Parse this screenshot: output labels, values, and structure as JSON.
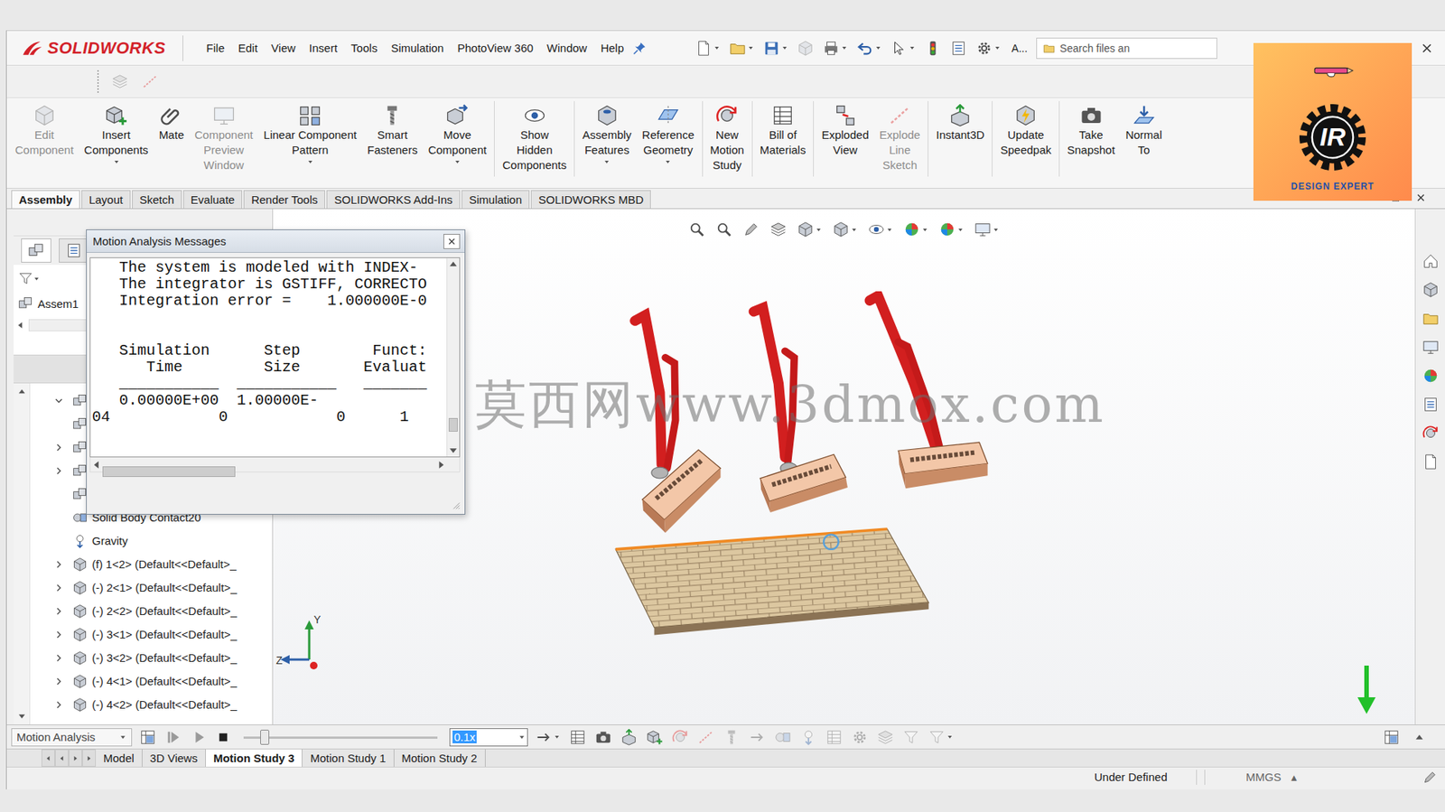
{
  "app": {
    "logo_text": "SOLIDWORKS"
  },
  "menu": [
    "File",
    "Edit",
    "View",
    "Insert",
    "Tools",
    "Simulation",
    "PhotoView 360",
    "Window",
    "Help"
  ],
  "quick_access": {
    "more_label": "A..."
  },
  "search": {
    "placeholder": "Search files an"
  },
  "ribbon": {
    "groups": [
      [
        {
          "label_lines": [
            "Edit",
            "Component"
          ],
          "disabled": true,
          "dropdown": false
        },
        {
          "label_lines": [
            "Insert",
            "Components"
          ],
          "disabled": false,
          "dropdown": true
        },
        {
          "label_lines": [
            "Mate"
          ],
          "disabled": false,
          "dropdown": false
        },
        {
          "label_lines": [
            "Component",
            "Preview",
            "Window"
          ],
          "disabled": true,
          "dropdown": false
        },
        {
          "label_lines": [
            "Linear Component",
            "Pattern"
          ],
          "disabled": false,
          "dropdown": true
        },
        {
          "label_lines": [
            "Smart",
            "Fasteners"
          ],
          "disabled": false,
          "dropdown": false
        },
        {
          "label_lines": [
            "Move",
            "Component"
          ],
          "disabled": false,
          "dropdown": true
        }
      ],
      [
        {
          "label_lines": [
            "Show",
            "Hidden",
            "Components"
          ],
          "disabled": false,
          "dropdown": false
        }
      ],
      [
        {
          "label_lines": [
            "Assembly",
            "Features"
          ],
          "disabled": false,
          "dropdown": true
        },
        {
          "label_lines": [
            "Reference",
            "Geometry"
          ],
          "disabled": false,
          "dropdown": true
        }
      ],
      [
        {
          "label_lines": [
            "New",
            "Motion",
            "Study"
          ],
          "disabled": false,
          "dropdown": false
        }
      ],
      [
        {
          "label_lines": [
            "Bill of",
            "Materials"
          ],
          "disabled": false,
          "dropdown": false
        }
      ],
      [
        {
          "label_lines": [
            "Exploded",
            "View"
          ],
          "disabled": false,
          "dropdown": false
        },
        {
          "label_lines": [
            "Explode",
            "Line",
            "Sketch"
          ],
          "disabled": true,
          "dropdown": false
        }
      ],
      [
        {
          "label_lines": [
            "Instant3D"
          ],
          "disabled": false,
          "dropdown": false
        }
      ],
      [
        {
          "label_lines": [
            "Update",
            "Speedpak"
          ],
          "disabled": false,
          "dropdown": false
        }
      ],
      [
        {
          "label_lines": [
            "Take",
            "Snapshot"
          ],
          "disabled": false,
          "dropdown": false
        },
        {
          "label_lines": [
            "Normal",
            "To"
          ],
          "disabled": false,
          "dropdown": false
        }
      ]
    ]
  },
  "command_tabs": [
    {
      "label": "Assembly",
      "selected": true
    },
    {
      "label": "Layout",
      "selected": false
    },
    {
      "label": "Sketch",
      "selected": false
    },
    {
      "label": "Evaluate",
      "selected": false
    },
    {
      "label": "Render Tools",
      "selected": false
    },
    {
      "label": "SOLIDWORKS Add-Ins",
      "selected": false
    },
    {
      "label": "Simulation",
      "selected": false
    },
    {
      "label": "SOLIDWORKS MBD",
      "selected": false
    }
  ],
  "feature_tree": {
    "root": "Assem1",
    "rows": [
      {
        "label": "",
        "kind": "covered",
        "expandable": true,
        "expanded": true
      },
      {
        "label": "",
        "kind": "covered",
        "expandable": false,
        "expanded": false
      },
      {
        "label": "",
        "kind": "covered",
        "expandable": true,
        "expanded": false
      },
      {
        "label": "",
        "kind": "covered",
        "expandable": true,
        "expanded": false
      },
      {
        "label": "",
        "kind": "covered",
        "expandable": false,
        "expanded": false
      },
      {
        "label": "Solid Body Contact20",
        "kind": "contact",
        "expandable": false,
        "expanded": false
      },
      {
        "label": "Gravity",
        "kind": "gravity",
        "expandable": false,
        "expanded": false
      },
      {
        "label": "(f) 1<2> (Default<<Default>_",
        "kind": "component",
        "expandable": true,
        "expanded": false
      },
      {
        "label": "(-) 2<1> (Default<<Default>_",
        "kind": "component",
        "expandable": true,
        "expanded": false
      },
      {
        "label": "(-) 2<2> (Default<<Default>_",
        "kind": "component",
        "expandable": true,
        "expanded": false
      },
      {
        "label": "(-) 3<1> (Default<<Default>_",
        "kind": "component",
        "expandable": true,
        "expanded": false
      },
      {
        "label": "(-) 3<2> (Default<<Default>_",
        "kind": "component",
        "expandable": true,
        "expanded": false
      },
      {
        "label": "(-) 4<1> (Default<<Default>_",
        "kind": "component",
        "expandable": true,
        "expanded": false
      },
      {
        "label": "(-) 4<2> (Default<<Default>_",
        "kind": "component",
        "expandable": true,
        "expanded": false
      }
    ]
  },
  "dialog": {
    "title": "Motion Analysis Messages",
    "lines": [
      "   The system is modeled with INDEX-",
      "   The integrator is GSTIFF, CORRECTO",
      "   Integration error =    1.000000E-0",
      "",
      "",
      "   Simulation      Step        Funct:",
      "      Time         Size       Evaluat",
      "   ___________  ___________   _______",
      "   0.00000E+00  1.00000E-",
      "04            0            0      1"
    ],
    "vertical_scroll_level": 0.92,
    "horizontal_scroll_level": 0.0
  },
  "viewport": {
    "watermark": "莫西网www.3dmox.com",
    "triad_axes": [
      {
        "label": "Y"
      },
      {
        "label": "Z"
      }
    ]
  },
  "motion_manager": {
    "study_type": "Motion Analysis",
    "timeline_level": 0.11,
    "speed": {
      "value": "0.1x",
      "selected": true
    }
  },
  "study_tabs": [
    {
      "label": "Model",
      "selected": false
    },
    {
      "label": "3D Views",
      "selected": false
    },
    {
      "label": "Motion Study 3",
      "selected": true
    },
    {
      "label": "Motion Study 1",
      "selected": false
    },
    {
      "label": "Motion Study 2",
      "selected": false
    }
  ],
  "status_bar": {
    "state": "Under Defined",
    "units": "MMGS",
    "units_arrow": "▴"
  },
  "channel_logo": {
    "monogram": "IR",
    "tagline": "DESIGN EXPERT"
  }
}
